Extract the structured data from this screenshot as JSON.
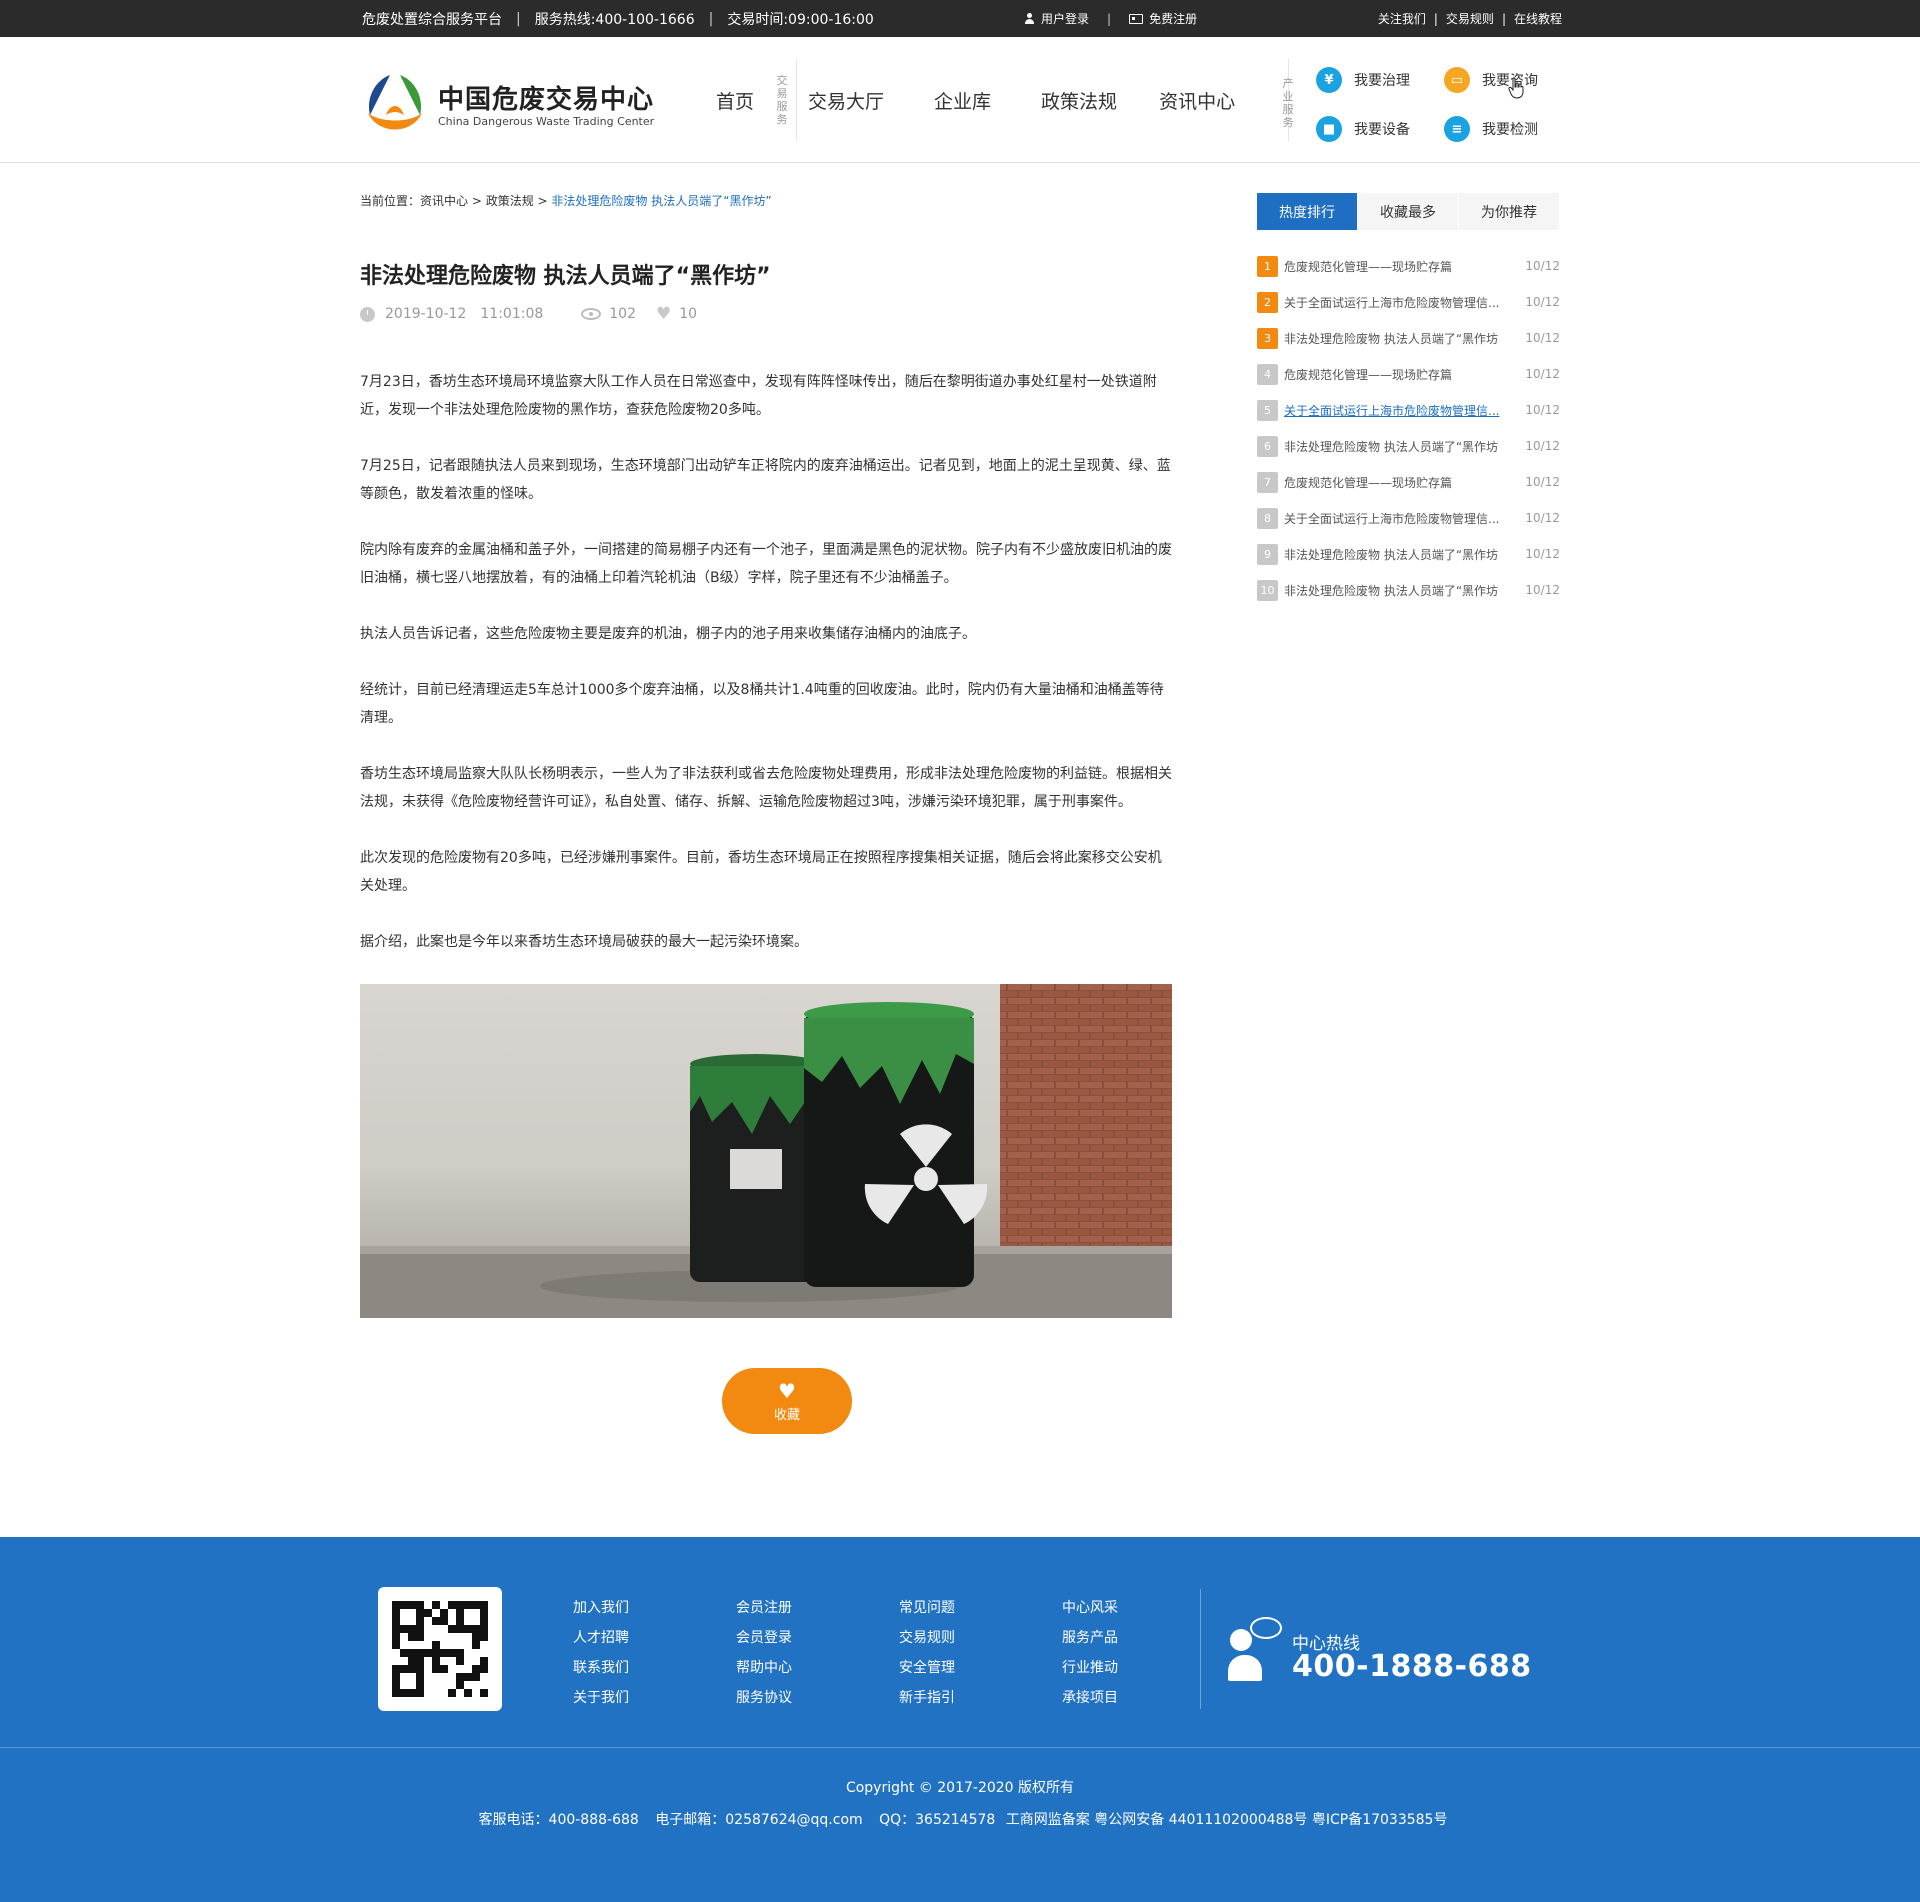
{
  "topbar": {
    "platform": "危废处置综合服务平台",
    "hotline": "服务热线:400-100-1666",
    "hours": "交易时间:09:00-16:00",
    "login": "用户登录",
    "register": "免费注册",
    "links": [
      "关注我们",
      "交易规则",
      "在线教程"
    ]
  },
  "header": {
    "logo_cn": "中国危废交易中心",
    "logo_en": "China Dangerous Waste Trading Center",
    "nav": [
      "首页",
      "交易大厅",
      "企业库",
      "政策法规",
      "资讯中心"
    ],
    "label_trade": "交易服务",
    "label_industry": "产业服务",
    "services": [
      {
        "label": "我要治理",
        "icon": "yen-icon",
        "color": "#1aa3e0"
      },
      {
        "label": "我要咨询",
        "icon": "chat-icon",
        "color": "#f5a623"
      },
      {
        "label": "我要设备",
        "icon": "truck-icon",
        "color": "#1aa3e0"
      },
      {
        "label": "我要检测",
        "icon": "list-icon",
        "color": "#1aa3e0"
      }
    ]
  },
  "breadcrumb": {
    "prefix": "当前位置：",
    "items": [
      "资讯中心",
      "政策法规"
    ],
    "current": "非法处理危险废物 执法人员端了“黑作坊”",
    "sep": " > "
  },
  "article": {
    "title": "非法处理危险废物 执法人员端了“黑作坊”",
    "date": "2019-10-12",
    "time": "11:01:08",
    "views": "102",
    "likes": "10",
    "paragraphs": [
      "7月23日，香坊生态环境局环境监察大队工作人员在日常巡查中，发现有阵阵怪味传出，随后在黎明街道办事处红星村一处铁道附近，发现一个非法处理危险废物的黑作坊，查获危险废物20多吨。",
      "7月25日，记者跟随执法人员来到现场，生态环境部门出动铲车正将院内的废弃油桶运出。记者见到，地面上的泥土呈现黄、绿、蓝等颜色，散发着浓重的怪味。",
      "院内除有废弃的金属油桶和盖子外，一间搭建的简易棚子内还有一个池子，里面满是黑色的泥状物。院子内有不少盛放废旧机油的废旧油桶，横七竖八地摆放着，有的油桶上印着汽轮机油（B级）字样，院子里还有不少油桶盖子。",
      "执法人员告诉记者，这些危险废物主要是废弃的机油，棚子内的池子用来收集储存油桶内的油底子。",
      "经统计，目前已经清理运走5车总计1000多个废弃油桶，以及8桶共计1.4吨重的回收废油。此时，院内仍有大量油桶和油桶盖等待清理。",
      "香坊生态环境局监察大队队长杨明表示，一些人为了非法获利或省去危险废物处理费用，形成非法处理危险废物的利益链。根据相关法规，未获得《危险废物经营许可证》，私自处置、储存、拆解、运输危险废物超过3吨，涉嫌污染环境犯罪，属于刑事案件。",
      "此次发现的危险废物有20多吨，已经涉嫌刑事案件。目前，香坊生态环境局正在按照程序搜集相关证据，随后会将此案移交公安机关处理。",
      "据介绍，此案也是今年以来香坊生态环境局破获的最大一起污染环境案。"
    ],
    "favorite_label": "收藏"
  },
  "sidebar": {
    "tabs": [
      "热度排行",
      "收藏最多",
      "为你推荐"
    ],
    "ranking": [
      {
        "num": "1",
        "title": "危废规范化管理——现场贮存篇",
        "date": "10/12"
      },
      {
        "num": "2",
        "title": "关于全面试运行上海市危险废物管理信...",
        "date": "10/12"
      },
      {
        "num": "3",
        "title": "非法处理危险废物 执法人员端了“黑作坊",
        "date": "10/12"
      },
      {
        "num": "4",
        "title": "危废规范化管理——现场贮存篇",
        "date": "10/12"
      },
      {
        "num": "5",
        "title": "关于全面试运行上海市危险废物管理信...",
        "date": "10/12"
      },
      {
        "num": "6",
        "title": "非法处理危险废物 执法人员端了“黑作坊",
        "date": "10/12"
      },
      {
        "num": "7",
        "title": "危废规范化管理——现场贮存篇",
        "date": "10/12"
      },
      {
        "num": "8",
        "title": "关于全面试运行上海市危险废物管理信...",
        "date": "10/12"
      },
      {
        "num": "9",
        "title": "非法处理危险废物 执法人员端了“黑作坊",
        "date": "10/12"
      },
      {
        "num": "10",
        "title": "非法处理危险废物 执法人员端了“黑作坊",
        "date": "10/12"
      }
    ]
  },
  "footer": {
    "columns": [
      [
        "加入我们",
        "人才招聘",
        "联系我们",
        "关于我们"
      ],
      [
        "会员注册",
        "会员登录",
        "帮助中心",
        "服务协议"
      ],
      [
        "常见问题",
        "交易规则",
        "安全管理",
        "新手指引"
      ],
      [
        "中心风采",
        "服务产品",
        "行业推动",
        "承接项目"
      ]
    ],
    "hotline_label": "中心热线",
    "hotline_number": "400-1888-688",
    "copyright": "Copyright © 2017-2020  版权所有",
    "info": [
      "客服电话：400-888-688",
      "电子邮箱：02587624@qq.com",
      "QQ：365214578",
      "工商网监备案",
      "粤公网安备 44011102000488号",
      "粤ICP备17033585号"
    ]
  },
  "colors": {
    "brand_blue": "#1e6ec2",
    "footer_blue": "#2272c3",
    "accent_orange": "#f28a12"
  }
}
